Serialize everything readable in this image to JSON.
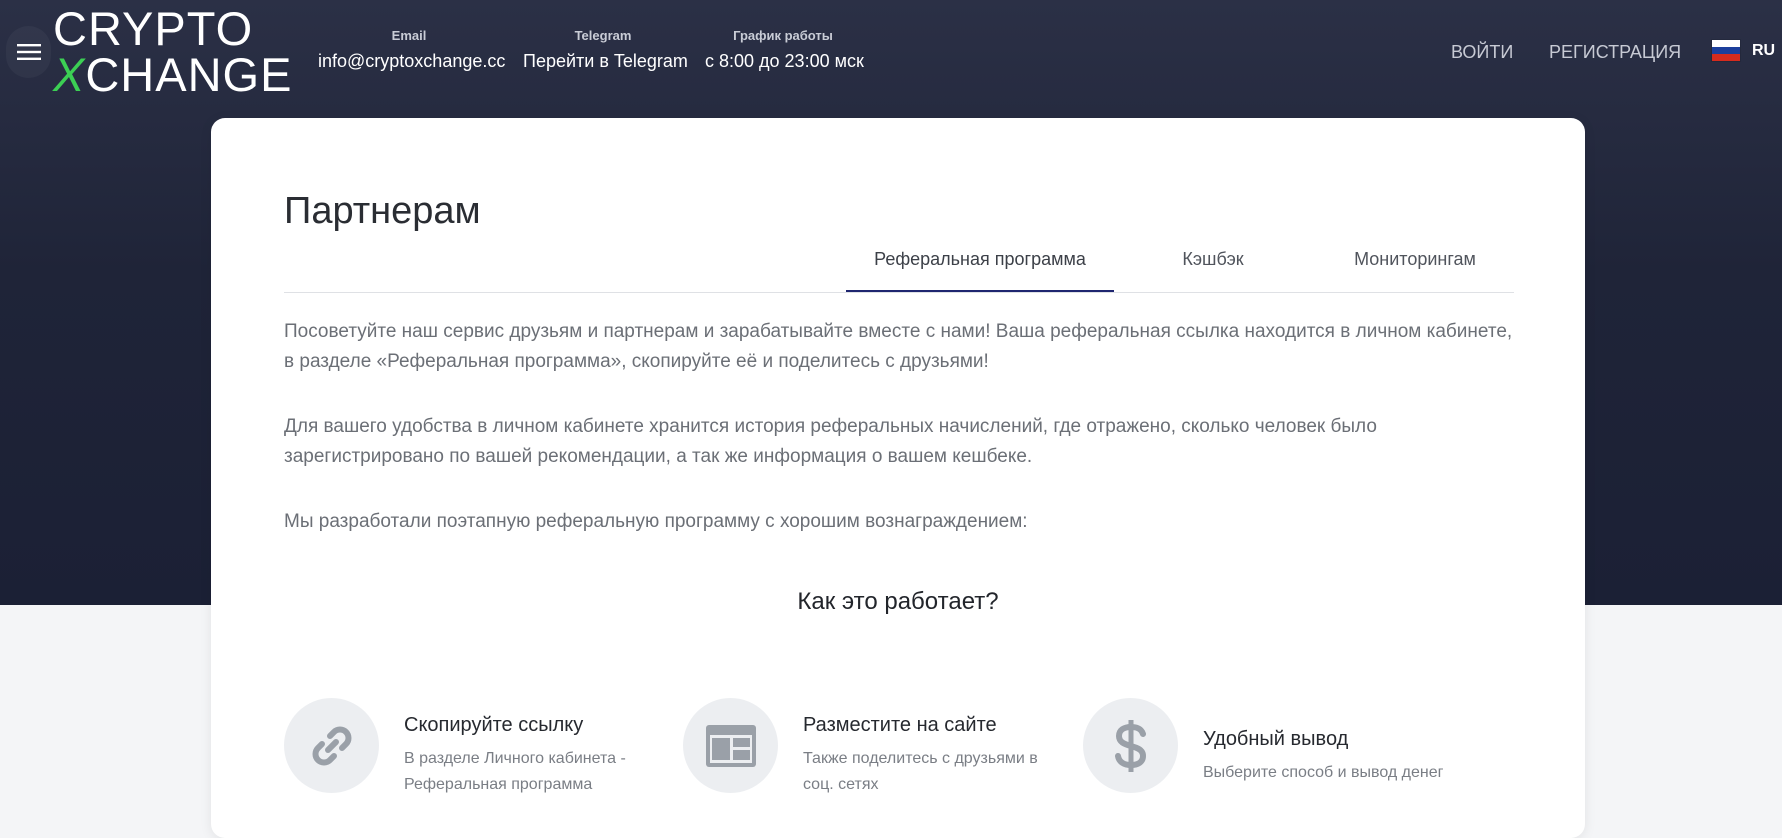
{
  "header": {
    "logo": {
      "line1": "CRYPTO",
      "line2_x": "X",
      "line2_rest": "CHANGE"
    },
    "contacts": [
      {
        "label": "Email",
        "value": "info@cryptoxchange.cc"
      },
      {
        "label": "Telegram",
        "value": "Перейти в Telegram"
      },
      {
        "label": "График работы",
        "value": "с 8:00 до 23:00 мск"
      }
    ],
    "nav": {
      "login": "ВОЙТИ",
      "register": "РЕГИСТРАЦИЯ"
    },
    "language": {
      "code": "RU",
      "flag_colors": [
        "#ffffff",
        "#1c3f9c",
        "#d52b1e"
      ]
    }
  },
  "page": {
    "title": "Партнерам",
    "tabs": [
      {
        "label": "Реферальная программа",
        "active": true
      },
      {
        "label": "Кэшбэк",
        "active": false
      },
      {
        "label": "Мониторингам",
        "active": false
      }
    ],
    "paragraphs": [
      "Посоветуйте наш сервис друзьям и партнерам и зарабатывайте вместе с нами! Ваша реферальная ссылка находится в личном кабинете, в разделе «Реферальная программа», скопируйте её и поделитесь с друзьями!",
      "Для вашего удобства в личном кабинете хранится история реферальных начислений, где отражено, сколько человек было зарегистрировано по вашей рекомендации, а так же информация о вашем кешбеке.",
      "Мы разработали поэтапную реферальную программу с хорошим вознаграждением:"
    ],
    "how_title": "Как это работает?",
    "steps": [
      {
        "icon": "link-icon",
        "title": "Скопируйте ссылку",
        "desc": "В разделе Личного кабинета - Реферальная программа"
      },
      {
        "icon": "web-layout-icon",
        "title": "Разместите на сайте",
        "desc": "Также поделитесь с друзьями в соц. сетях"
      },
      {
        "icon": "dollar-icon",
        "title": "Удобный вывод",
        "desc": "Выберите способ и вывод денег"
      }
    ]
  },
  "colors": {
    "header_bg": "#1f2438",
    "accent_green": "#3ccf54",
    "tab_active_underline": "#1f2670",
    "icon_gray": "#9aa0a8"
  }
}
